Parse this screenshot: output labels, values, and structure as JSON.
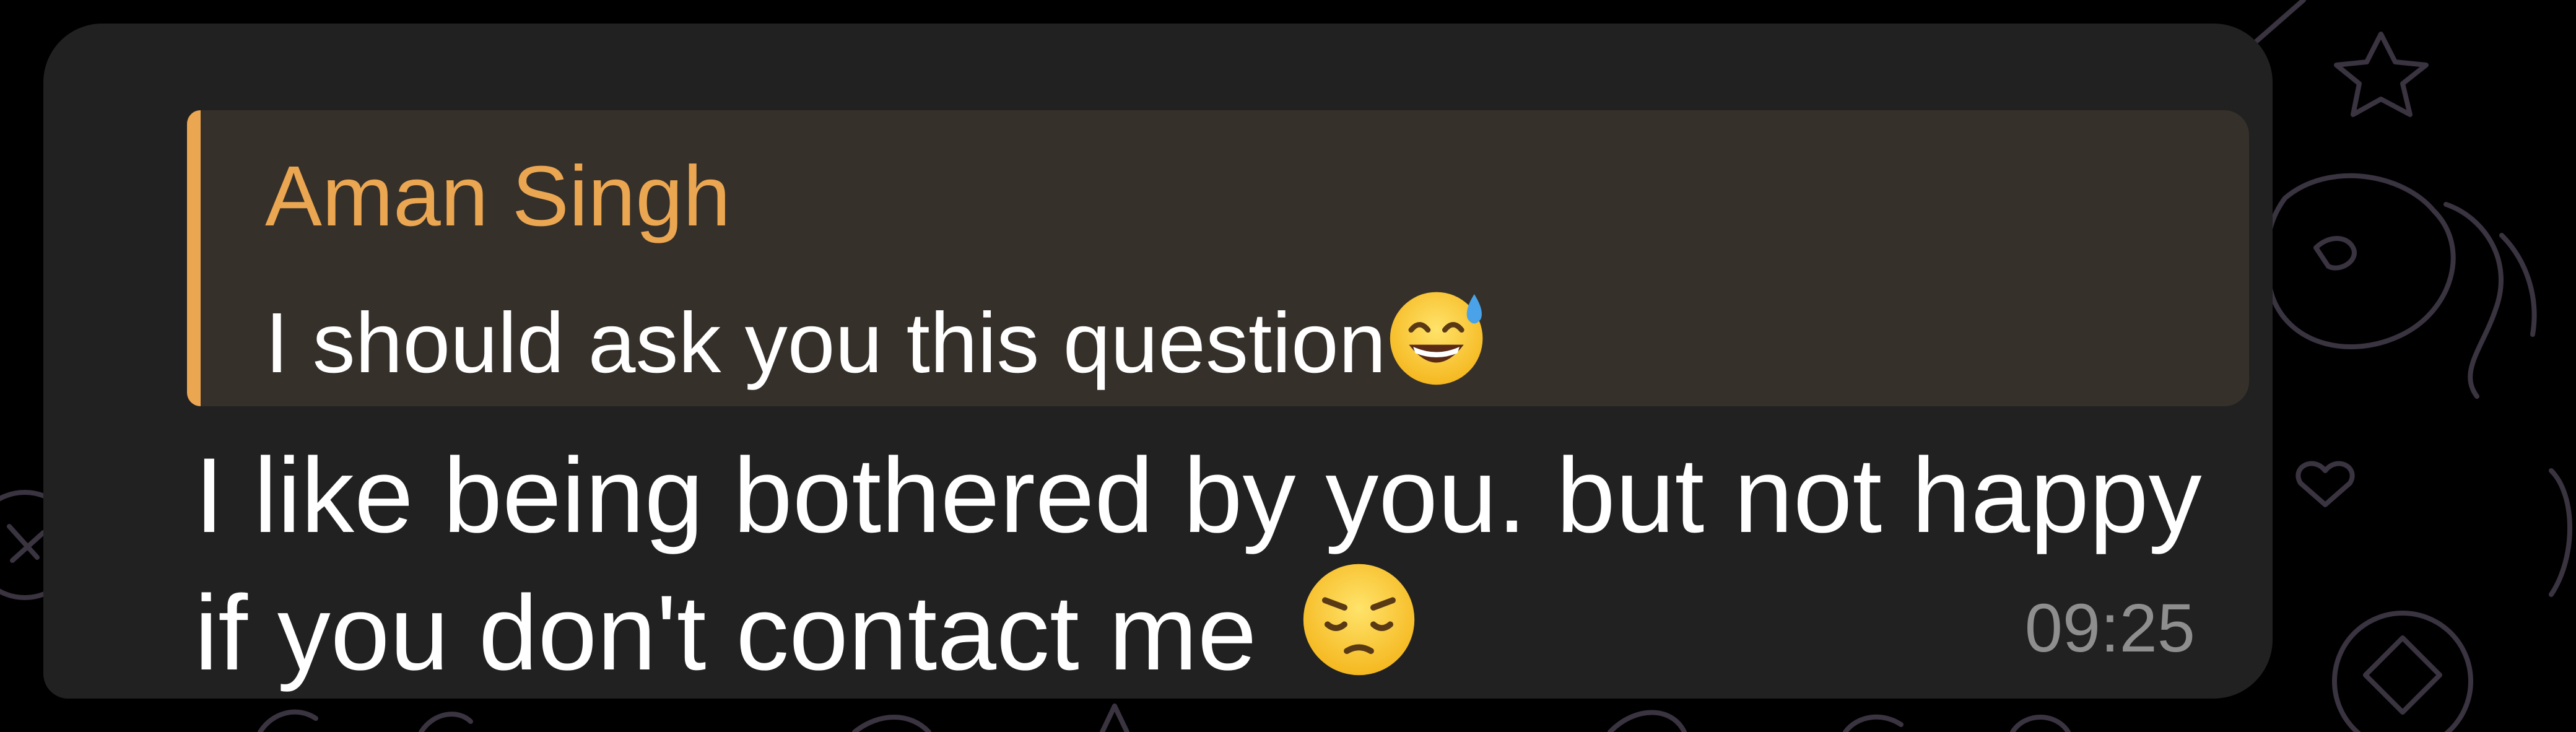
{
  "message": {
    "reply": {
      "author": "Aman Singh",
      "text": "I should ask you this question",
      "emoji_icon": "grinning-sweat-emoji-icon"
    },
    "lines": [
      "I like being bothered by you.  but not happy",
      "if you don't contact me "
    ],
    "emoji_icon": "pensive-face-emoji-icon",
    "time": "09:25"
  },
  "colors": {
    "background": "#000000",
    "bubble": "#212121",
    "reply_background": "#36302a",
    "reply_accent": "#eba652",
    "text": "#ffffff",
    "timestamp": "#8e8e8e"
  }
}
